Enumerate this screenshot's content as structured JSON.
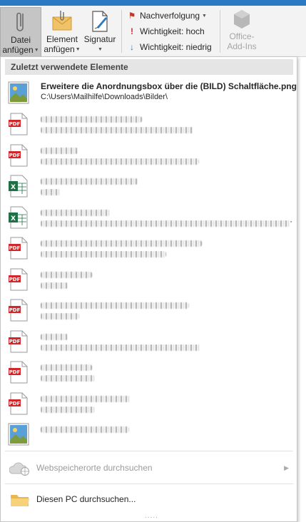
{
  "ribbon": {
    "attach_file": {
      "line1": "Datei",
      "line2": "anfügen"
    },
    "attach_item": {
      "line1": "Element",
      "line2": "anfügen"
    },
    "signature": {
      "line1": "Signatur"
    },
    "followup": "Nachverfolgung",
    "importance_high": "Wichtigkeit: hoch",
    "importance_low": "Wichtigkeit: niedrig",
    "office_addins": {
      "line1": "Office-",
      "line2": "Add-Ins"
    }
  },
  "menu": {
    "header": "Zuletzt verwendete Elemente",
    "first_item": {
      "name": "Erweitere die Anordnungsbox über die (BILD) Schaltfläche.png",
      "path": "C:\\Users\\Mailhilfe\\Downloads\\Bilder\\",
      "icon": "image-file-icon"
    },
    "blurred_items": [
      {
        "icon": "pdf-icon"
      },
      {
        "icon": "pdf-icon"
      },
      {
        "icon": "excel-icon"
      },
      {
        "icon": "excel-icon",
        "suffix": "T\\"
      },
      {
        "icon": "pdf-icon"
      },
      {
        "icon": "pdf-icon"
      },
      {
        "icon": "pdf-icon"
      },
      {
        "icon": "pdf-icon"
      },
      {
        "icon": "pdf-icon"
      },
      {
        "icon": "pdf-icon"
      },
      {
        "icon": "image-file-icon"
      }
    ],
    "web_locations": "Webspeicherorte durchsuchen",
    "this_pc": "Diesen PC durchsuchen...",
    "grip": "....."
  },
  "colors": {
    "titlebar": "#2b78c5",
    "ribbon_bg": "#f3f3f3",
    "pressed": "#c5c5c5",
    "header_bg": "#e5e5e5",
    "pdf_red": "#d0282a",
    "excel_green": "#1e7145"
  }
}
